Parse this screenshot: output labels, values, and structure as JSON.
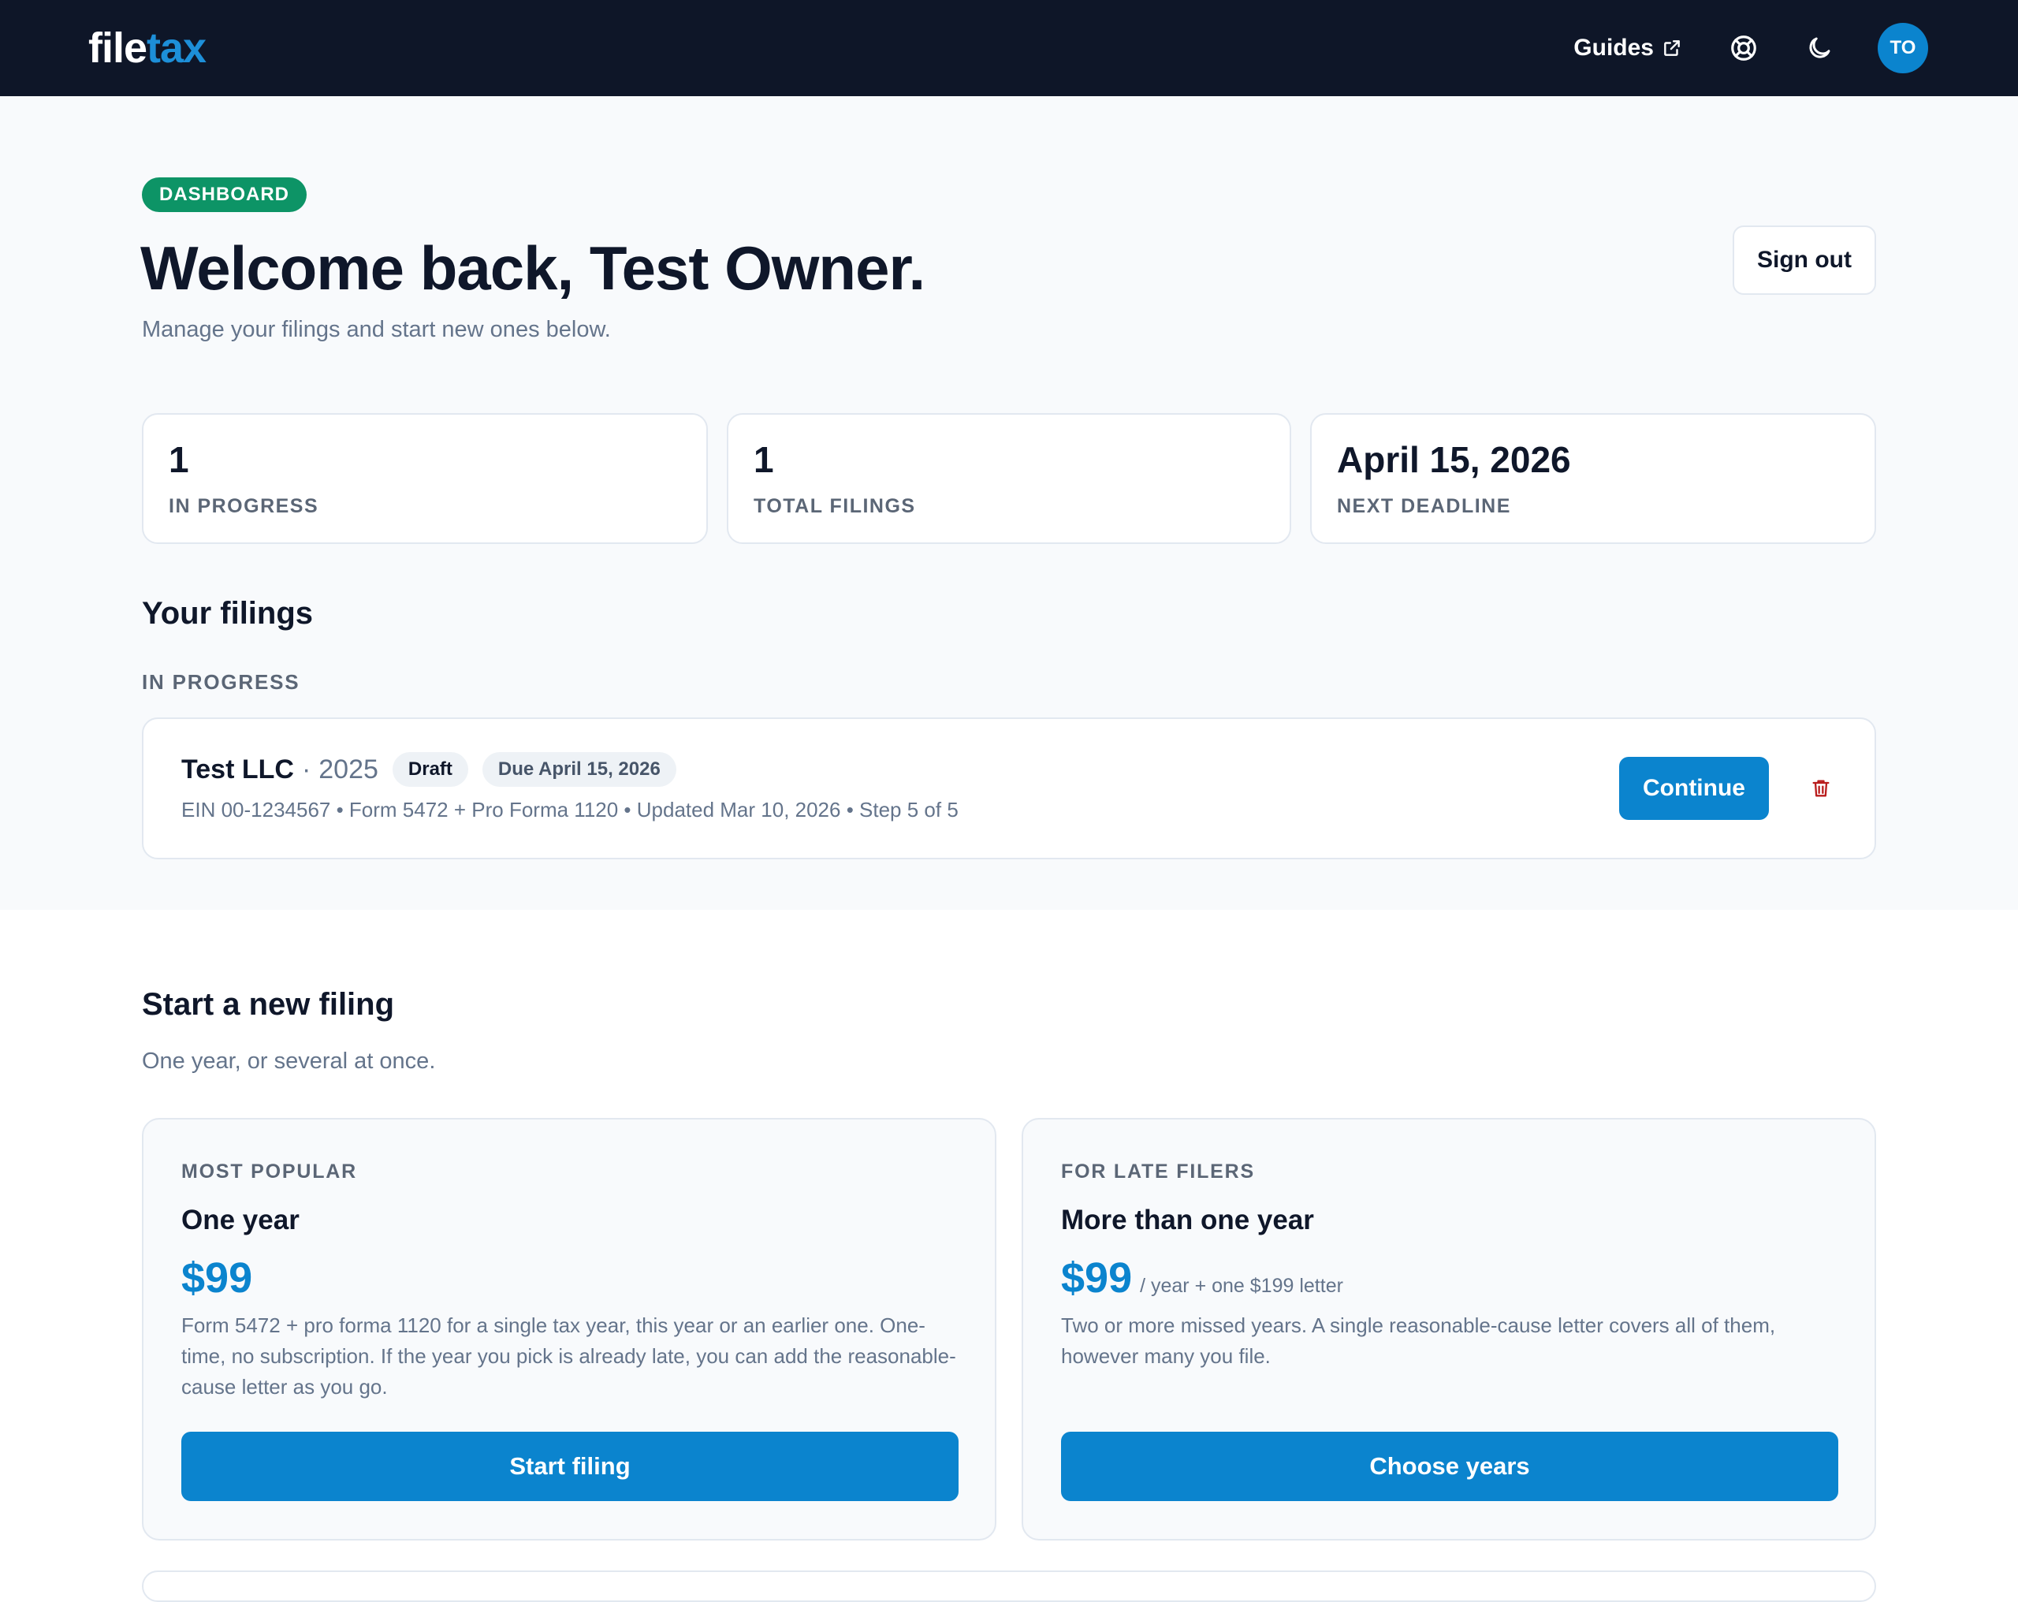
{
  "header": {
    "logo_part1": "file",
    "logo_part2": "tax",
    "guides_label": "Guides",
    "avatar_initials": "TO"
  },
  "hero": {
    "badge": "DASHBOARD",
    "title": "Welcome back, Test Owner.",
    "subtitle": "Manage your filings and start new ones below.",
    "sign_out": "Sign out"
  },
  "stats": [
    {
      "value": "1",
      "label": "IN PROGRESS"
    },
    {
      "value": "1",
      "label": "TOTAL FILINGS"
    },
    {
      "value": "April 15, 2026",
      "label": "NEXT DEADLINE"
    }
  ],
  "filings": {
    "title": "Your filings",
    "group_label": "IN PROGRESS",
    "items": [
      {
        "company": "Test LLC",
        "separator": "·",
        "year": "2025",
        "status": "Draft",
        "due": "Due April 15, 2026",
        "meta": "EIN 00-1234567 • Form 5472 + Pro Forma 1120 • Updated Mar 10, 2026 • Step 5 of 5",
        "continue_label": "Continue"
      }
    ]
  },
  "new_filing": {
    "title": "Start a new filing",
    "subtitle": "One year, or several at once.",
    "plans": [
      {
        "kicker": "MOST POPULAR",
        "name": "One year",
        "price": "$99",
        "per": "",
        "description": "Form 5472 + pro forma 1120 for a single tax year, this year or an earlier one. One-time, no subscription. If the year you pick is already late, you can add the reasonable-cause letter as you go.",
        "cta": "Start filing"
      },
      {
        "kicker": "FOR LATE FILERS",
        "name": "More than one year",
        "price": "$99",
        "per": "/ year + one $199 letter",
        "description": "Two or more missed years. A single reasonable-cause letter covers all of them, however many you file.",
        "cta": "Choose years"
      }
    ]
  },
  "colors": {
    "nav_bg": "#0e1628",
    "accent": "#0b84ce",
    "badge_green": "#0d9466",
    "danger": "#b91c1c"
  },
  "icons": [
    "external-link-icon",
    "lifebuoy-icon",
    "moon-icon",
    "trash-icon"
  ]
}
